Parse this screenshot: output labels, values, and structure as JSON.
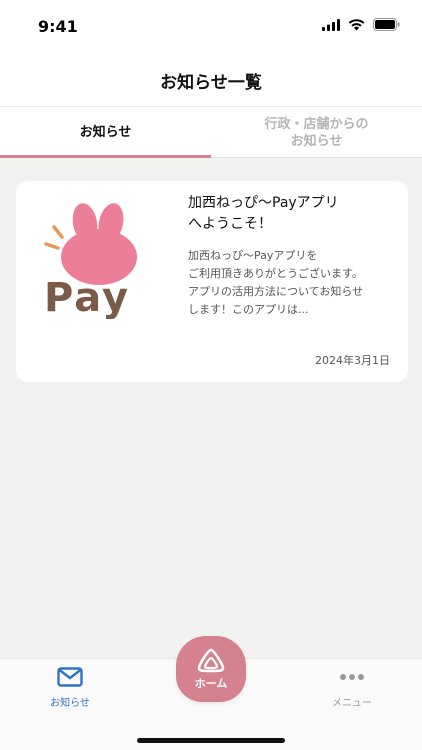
{
  "status_bar": {
    "time": "9:41",
    "icons": [
      "signal-icon",
      "wifi-icon",
      "battery-icon"
    ]
  },
  "header": {
    "title": "お知らせ一覧"
  },
  "tabs": [
    {
      "label": "お知らせ",
      "active": true
    },
    {
      "label": "行政・店舗からの\nお知らせ",
      "active": false
    }
  ],
  "notices": [
    {
      "title": "加西ねっぴ〜Payアプリ\nへようこそ！",
      "excerpt": "加西ねっぴ〜Payアプリを\nご利用頂きありがとうございます。\nアプリの活用方法についてお知らせ\nします！このアプリは...",
      "date": "2024年3月1日",
      "logo": {
        "icon": "rabbit-pay-logo",
        "text": "Pay"
      }
    }
  ],
  "bottom_nav": {
    "notice_label": "お知らせ",
    "home_label": "ホーム",
    "menu_label": "メニュー"
  },
  "colors": {
    "accent_pink": "#d5818e",
    "active_nav_blue": "#2f73c5",
    "background": "#f2f2f0"
  }
}
